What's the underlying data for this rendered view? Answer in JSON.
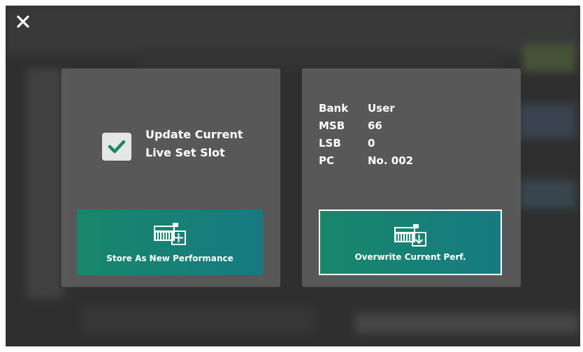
{
  "dialog": {
    "close_icon": "close-icon",
    "update_checkbox": {
      "checked": true,
      "label_line1": "Update Current",
      "label_line2": "Live Set Slot"
    },
    "store_button": {
      "label": "Store As New Performance",
      "icon": "store-new-icon"
    },
    "info": [
      {
        "key": "Bank",
        "value": "User"
      },
      {
        "key": "MSB",
        "value": "66"
      },
      {
        "key": "LSB",
        "value": "0"
      },
      {
        "key": "PC",
        "value": "No. 002"
      }
    ],
    "overwrite_button": {
      "label": "Overwrite Current Perf.",
      "icon": "overwrite-icon"
    }
  },
  "colors": {
    "button_green": "#17876a",
    "button_teal": "#177a82",
    "checkbox_bg": "#e6e6e6",
    "check_mark": "#17876a",
    "panel_bg": "#5f5f5f"
  }
}
